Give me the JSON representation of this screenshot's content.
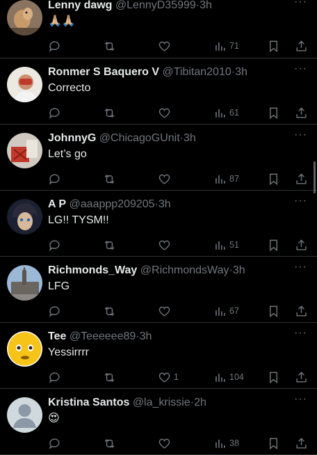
{
  "tweets": [
    {
      "name": "Lenny dawg",
      "handle": "@LennyD35999",
      "sep": "·",
      "time": "3h",
      "text": "🙏🏼🙏🏼",
      "likes": "",
      "views": "71",
      "avatar": "dog"
    },
    {
      "name": "Ronmer S Baquero V",
      "handle": "@Tibitan2010",
      "sep": "·",
      "time": "3h",
      "text": "Correcto",
      "likes": "",
      "views": "61",
      "avatar": "person-red"
    },
    {
      "name": "JohnnyG",
      "handle": "@ChicagoGUnit",
      "sep": "·",
      "time": "3h",
      "text": "Let’s go",
      "likes": "",
      "views": "87",
      "avatar": "red-object"
    },
    {
      "name": "A P",
      "handle": "@aaappp209205",
      "sep": "·",
      "time": "3h",
      "text": "LG!! TYSM!!",
      "likes": "",
      "views": "51",
      "avatar": "anime"
    },
    {
      "name": "Richmonds_Way",
      "handle": "@RichmondsWay",
      "sep": "·",
      "time": "3h",
      "text": "LFG",
      "likes": "",
      "views": "67",
      "avatar": "building"
    },
    {
      "name": "Tee",
      "handle": "@Teeeeee89",
      "sep": "·",
      "time": "3h",
      "text": "Yessirrrr",
      "likes": "1",
      "views": "104",
      "avatar": "emoji-face"
    },
    {
      "name": "Kristina Santos",
      "handle": "@la_krissie",
      "sep": "·",
      "time": "2h",
      "text": "😍",
      "likes": "",
      "views": "38",
      "avatar": "default-user"
    }
  ],
  "more_label": "···",
  "colors": {
    "bg": "#000000",
    "text": "#e7e9ea",
    "muted": "#71767b",
    "divider": "#2f3336"
  }
}
